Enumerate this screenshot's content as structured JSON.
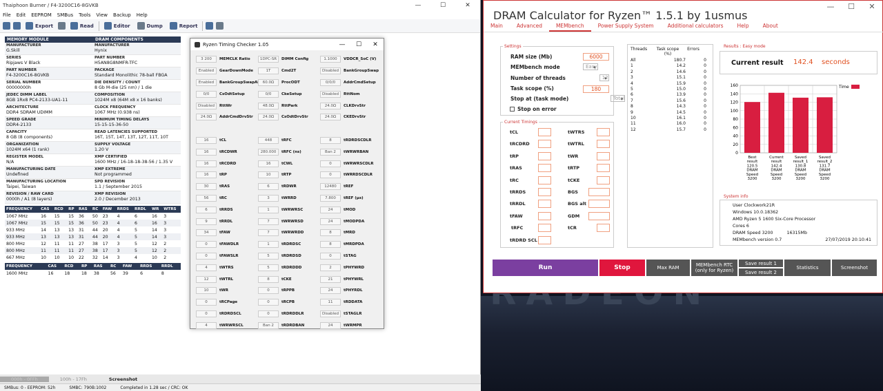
{
  "thaiphoon": {
    "title": "Thaiphoon Burner / F4-3200C16-8GVKB",
    "menu": [
      "File",
      "Edit",
      "EEPROM",
      "SMBus",
      "Tools",
      "View",
      "Backup",
      "Help"
    ],
    "toolbar": [
      "Export",
      "Read",
      "Editor",
      "Dump",
      "Report"
    ],
    "spd_left_header": "MEMORY MODULE",
    "spd_right_header": "DRAM COMPONENTS",
    "spd": [
      {
        "k1": "MANUFACTURER",
        "v1": "G.Skill",
        "k2": "MANUFACTURER",
        "v2": "Hynix"
      },
      {
        "k1": "SERIES",
        "v1": "Ripjaws V Black",
        "k2": "PART NUMBER",
        "v2": "H5AN8G8NMFR-TFC"
      },
      {
        "k1": "PART NUMBER",
        "v1": "F4-3200C16-8GVKB",
        "k2": "PACKAGE",
        "v2": "Standard Monolithic 78-ball FBGA"
      },
      {
        "k1": "SERIAL NUMBER",
        "v1": "00000000h",
        "k2": "DIE DENSITY / COUNT",
        "v2": "8 Gb M-die (25 nm) / 1 die"
      },
      {
        "k1": "JEDEC DIMM LABEL",
        "v1": "8GB 1Rx8 PC4-2133-UA1-11",
        "k2": "COMPOSITION",
        "v2": "1024M x8 (64M x8 x 16 banks)"
      },
      {
        "k1": "ARCHITECTURE",
        "v1": "DDR4 SDRAM UDIMM",
        "k2": "CLOCK FREQUENCY",
        "v2": "1067 MHz (0.938 ns)"
      },
      {
        "k1": "SPEED GRADE",
        "v1": "DDR4-2133",
        "k2": "MINIMUM TIMING DELAYS",
        "v2": "15-15-15-36-50"
      },
      {
        "k1": "CAPACITY",
        "v1": "8 GB (8 components)",
        "k2": "READ LATENCIES SUPPORTED",
        "v2": "16T, 15T, 14T, 13T, 12T, 11T, 10T"
      },
      {
        "k1": "ORGANIZATION",
        "v1": "1024M x64 (1 rank)",
        "k2": "SUPPLY VOLTAGE",
        "v2": "1.20 V"
      },
      {
        "k1": "REGISTER MODEL",
        "v1": "N/A",
        "k2": "XMP CERTIFIED",
        "v2": "1600 MHz / 16-18-18-38-56 / 1.35 V"
      },
      {
        "k1": "MANUFACTURING DATE",
        "v1": "Undefined",
        "k2": "XMP EXTREME",
        "v2": "Not programmed"
      },
      {
        "k1": "MANUFACTURING LOCATION",
        "v1": "Taipei, Taiwan",
        "k2": "SPD REVISION",
        "v2": "1.1 / September 2015"
      },
      {
        "k1": "REVISION / RAW CARD",
        "v1": "0000h / A1 (8 layers)",
        "k2": "XMP REVISION",
        "v2": "2.0 / December 2013"
      }
    ],
    "freq_headers": [
      "FREQUENCY",
      "CAS",
      "RCD",
      "RP",
      "RAS",
      "RC",
      "FAW",
      "RRDS",
      "RRDL",
      "WR",
      "WTRS"
    ],
    "freq_rows": [
      [
        "1067 MHz",
        "16",
        "15",
        "15",
        "36",
        "50",
        "23",
        "4",
        "6",
        "16",
        "3"
      ],
      [
        "1067 MHz",
        "15",
        "15",
        "15",
        "36",
        "50",
        "23",
        "4",
        "6",
        "16",
        "3"
      ],
      [
        "933 MHz",
        "14",
        "13",
        "13",
        "31",
        "44",
        "20",
        "4",
        "5",
        "14",
        "3"
      ],
      [
        "933 MHz",
        "13",
        "13",
        "13",
        "31",
        "44",
        "20",
        "4",
        "5",
        "14",
        "3"
      ],
      [
        "800 MHz",
        "12",
        "11",
        "11",
        "27",
        "38",
        "17",
        "3",
        "5",
        "12",
        "2"
      ],
      [
        "800 MHz",
        "11",
        "11",
        "11",
        "27",
        "38",
        "17",
        "3",
        "5",
        "12",
        "2"
      ],
      [
        "667 MHz",
        "10",
        "10",
        "10",
        "22",
        "32",
        "14",
        "3",
        "4",
        "10",
        "2"
      ]
    ],
    "xmp_headers": [
      "FREQUENCY",
      "CAS",
      "RCD",
      "RP",
      "RAS",
      "RC",
      "FAW",
      "RRDS",
      "RRDL"
    ],
    "xmp_row": [
      "1600 MHz",
      "16",
      "18",
      "18",
      "38",
      "56",
      "39",
      "6",
      "8"
    ],
    "tabs": [
      "100h - 17Fh",
      "Screenshot"
    ],
    "status": [
      "SMBus: 0 - EEPROM: 52h",
      "SMBC: 790B:1002",
      "Completed in 1.28 sec / CRC: OK"
    ]
  },
  "rtc": {
    "title": "Ryzen Timing Checker 1.05",
    "rows": [
      [
        [
          "3 200",
          "MEMCLK Ratio"
        ],
        [
          "1DPC-SR",
          "DIMM Config"
        ],
        [
          "1.1000",
          "VDDCR_SoC (V)"
        ]
      ],
      [
        [
          "Enabled",
          "GearDownMode"
        ],
        [
          "1T",
          "Cmd2T"
        ],
        [
          "Disabled",
          "BankGroupSwap"
        ]
      ],
      [
        [
          "Enabled",
          "BankGroupSwapAlt"
        ],
        [
          "60.0Ω",
          "ProcODT"
        ],
        [
          "0/0/0",
          "AddrCmdSetup"
        ]
      ],
      [
        [
          "0/0",
          "CsOdtSetup"
        ],
        [
          "0/0",
          "CkeSetup"
        ],
        [
          "Disabled",
          "RttNom"
        ]
      ],
      [
        [
          "Disabled",
          "RttWr"
        ],
        [
          "48.0Ω",
          "RttPark"
        ],
        [
          "24.0Ω",
          "CLKDrvStr"
        ]
      ],
      [
        [
          "24.0Ω",
          "AddrCmdDrvStr"
        ],
        [
          "24.0Ω",
          "CsOdtDrvStr"
        ],
        [
          "24.0Ω",
          "CKEDrvStr"
        ]
      ],
      [
        [
          "",
          "",
          ""
        ],
        [
          "",
          ""
        ],
        [
          "",
          ""
        ]
      ],
      [
        [
          "16",
          "tCL"
        ],
        [
          "448",
          "tRFC"
        ],
        [
          "8",
          "tRDRDSCDLR"
        ]
      ],
      [
        [
          "16",
          "tRCDWR"
        ],
        [
          "280.000",
          "tRFC (ns)"
        ],
        [
          "Ban 2",
          "tWRWRBAN"
        ]
      ],
      [
        [
          "16",
          "tRCDRD"
        ],
        [
          "16",
          "tCWL"
        ],
        [
          "0",
          "tWRWRSCDLR"
        ]
      ],
      [
        [
          "16",
          "tRP"
        ],
        [
          "10",
          "tRTP"
        ],
        [
          "0",
          "tWRRDSCDLR"
        ]
      ],
      [
        [
          "30",
          "tRAS"
        ],
        [
          "6",
          "tRDWR"
        ],
        [
          "12480",
          "tREF"
        ]
      ],
      [
        [
          "56",
          "tRC"
        ],
        [
          "3",
          "tWRRD"
        ],
        [
          "7.800",
          "tREF (µs)"
        ]
      ],
      [
        [
          "6",
          "tRRDS"
        ],
        [
          "1",
          "tWRWRSC"
        ],
        [
          "24",
          "tMOD"
        ]
      ],
      [
        [
          "9",
          "tRRDL"
        ],
        [
          "7",
          "tWRWRSD"
        ],
        [
          "24",
          "tMODPDA"
        ]
      ],
      [
        [
          "34",
          "tFAW"
        ],
        [
          "7",
          "tWRWRDD"
        ],
        [
          "8",
          "tMRD"
        ]
      ],
      [
        [
          "0",
          "tFAWDLR"
        ],
        [
          "1",
          "tRDRDSC"
        ],
        [
          "8",
          "tMRDPDA"
        ]
      ],
      [
        [
          "0",
          "tFAWSLR"
        ],
        [
          "5",
          "tRDRDSD"
        ],
        [
          "0",
          "tSTAG"
        ]
      ],
      [
        [
          "4",
          "tWTRS"
        ],
        [
          "5",
          "tRDRDDD"
        ],
        [
          "2",
          "tPHYWRD"
        ]
      ],
      [
        [
          "12",
          "tWTRL"
        ],
        [
          "8",
          "tCKE"
        ],
        [
          "21",
          "tPHYWRL"
        ]
      ],
      [
        [
          "10",
          "tWR"
        ],
        [
          "0",
          "tRPPB"
        ],
        [
          "24",
          "tPHYRDL"
        ]
      ],
      [
        [
          "0",
          "tRCPage"
        ],
        [
          "0",
          "tRCPB"
        ],
        [
          "11",
          "tRDDATA"
        ]
      ],
      [
        [
          "0",
          "tRDRDSCL"
        ],
        [
          "0",
          "tRDRDDLR"
        ],
        [
          "Disabled",
          "tSTAGLR"
        ]
      ],
      [
        [
          "4",
          "tWRWRSCL"
        ],
        [
          "Ban 2",
          "tRDRDBAN"
        ],
        [
          "24",
          "tWRMPR"
        ]
      ]
    ]
  },
  "dram": {
    "title": "DRAM Calculator for Ryzen™ 1.5.1 by 1usmus",
    "tabs": [
      "Main",
      "Advanced",
      "MEMbench",
      "Power Supply System",
      "Additional calculators",
      "Help",
      "About"
    ],
    "settings_label": "Settings",
    "ram_size_label": "RAM size (Mb)",
    "ram_size": "6000",
    "mode_label": "MEMbench mode",
    "mode": "Easy",
    "threads_label": "Number of threads",
    "threads": "12",
    "scope_label": "Task scope (%)",
    "scope": "180",
    "stop_label": "Stop at (task mode)",
    "stop": "Total",
    "error_label": "Stop on error",
    "current_timings_label": "Current Timings",
    "timings_left": [
      "tCL",
      "tRCDRD",
      "tRP",
      "tRAS",
      "tRC",
      "tRRDS",
      "tRRDL",
      "tFAW",
      "tRFC",
      "tRDRD SCL"
    ],
    "timings_right": [
      "tWTRS",
      "tWTRL",
      "tWR",
      "tRTP",
      "tCKE",
      "BGS",
      "BGS alt",
      "GDM",
      "tCR"
    ],
    "thread_headers": [
      "Threads",
      "Task scope (%)",
      "Errors"
    ],
    "thread_rows": [
      [
        "All",
        "180.7",
        "0"
      ],
      [
        "1",
        "14.2",
        "0"
      ],
      [
        "2",
        "14.6",
        "0"
      ],
      [
        "3",
        "15.1",
        "0"
      ],
      [
        "4",
        "15.9",
        "0"
      ],
      [
        "5",
        "15.0",
        "0"
      ],
      [
        "6",
        "13.9",
        "0"
      ],
      [
        "7",
        "15.6",
        "0"
      ],
      [
        "8",
        "14.3",
        "0"
      ],
      [
        "9",
        "14.5",
        "0"
      ],
      [
        "10",
        "16.1",
        "0"
      ],
      [
        "11",
        "16.0",
        "0"
      ],
      [
        "12",
        "15.7",
        "0"
      ]
    ],
    "results_label": "Results : Easy mode",
    "current_result_label": "Current result",
    "current_result": "142.4",
    "seconds": "seconds",
    "sysinfo_label": "System info",
    "sysinfo": [
      "User Clockwork21R",
      "Windows 10.0.18362",
      "AMD Ryzen 5 1600 Six-Core Processor",
      "Cores 6"
    ],
    "dram_speed": "DRAM Speed 3200",
    "mem_size": "16315Mb",
    "membench_version": "MEMbench version 0.7",
    "timestamp": "27/07/2019 20:10:41",
    "buttons": {
      "run": "Run",
      "stop": "Stop",
      "max_ram": "Max RAM",
      "rtc": "MEMbench RTC (only for Ryzen)",
      "save1": "Save result 1",
      "save2": "Save result 2",
      "statistics": "Statistics",
      "screenshot": "Screenshot"
    },
    "bg_text": "RADEON"
  },
  "chart_data": {
    "type": "bar",
    "categories": [
      "Best result",
      "Current result",
      "Saved result_1",
      "Saved result_2"
    ],
    "category_lines": [
      [
        "Best",
        "result",
        "120.5",
        "DRAM",
        "Speed",
        "3200"
      ],
      [
        "Current",
        "result",
        "142.4",
        "DRAM",
        "Speed",
        "3200"
      ],
      [
        "Saved",
        "result_1",
        "130.8",
        "DRAM",
        "Speed",
        "3200"
      ],
      [
        "Saved",
        "result_2",
        "131.7",
        "DRAM",
        "Speed",
        "3200"
      ]
    ],
    "values": [
      120.5,
      142.4,
      130.8,
      131.7
    ],
    "legend": "Time",
    "yticks": [
      "0",
      "20",
      "40",
      "60",
      "80",
      "100",
      "120",
      "140",
      "160"
    ],
    "ylim": [
      0,
      160
    ],
    "bar_color": "#d81e40",
    "grid": true,
    "legend_position": "top-right"
  }
}
